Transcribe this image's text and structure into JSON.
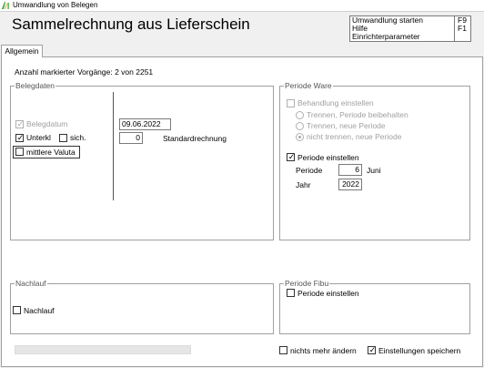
{
  "window": {
    "title": "Umwandlung von Belegen",
    "heading": "Sammelrechnung aus Lieferschein"
  },
  "shortcuts": [
    {
      "label": "Umwandlung starten",
      "key": "F9"
    },
    {
      "label": "Hilfe",
      "key": "F1"
    },
    {
      "label": "Einrichterparameter",
      "key": ""
    }
  ],
  "tabs": [
    {
      "label": "Allgemein"
    }
  ],
  "info": {
    "marked_count": "Anzahl markierter Vorgänge: 2 von 2251"
  },
  "belegdaten": {
    "legend": "Belegdaten",
    "belegdatum_label": "Belegdatum",
    "belegdatum_value": "09.06.2022",
    "belegdatum_checked": true,
    "unterkl_label": "Unterkl",
    "unterkl_checked": true,
    "sich_label": "sich.",
    "sich_checked": false,
    "number_value": "0",
    "standard_label": "Standardrechnung",
    "valuta_label": "mittlere Valuta",
    "valuta_checked": false
  },
  "periode_ware": {
    "legend": "Periode Ware",
    "behandlung_label": "Behandlung einstellen",
    "radio_options": [
      {
        "label": "Trennen, Periode beibehalten",
        "selected": false
      },
      {
        "label": "Trennen, neue Periode",
        "selected": false
      },
      {
        "label": "nicht trennen, neue Periode",
        "selected": true
      }
    ],
    "periode_einstellen_label": "Periode einstellen",
    "periode_einstellen_checked": true,
    "periode_label": "Periode",
    "periode_value": "6",
    "periode_month": "Juni",
    "jahr_label": "Jahr",
    "jahr_value": "2022"
  },
  "nachlauf": {
    "legend": "Nachlauf",
    "checkbox_label": "Nachlauf",
    "checked": false
  },
  "periode_fibu": {
    "legend": "Periode Fibu",
    "checkbox_label": "Periode einstellen",
    "checked": false
  },
  "footer": {
    "nichts_label": "nichts mehr ändern",
    "nichts_checked": false,
    "speichern_label": "Einstellungen speichern",
    "speichern_checked": true
  },
  "icons": {
    "app": "app-logo-icon",
    "check_mark": "✓"
  },
  "colors": {
    "background": "#f0f0f0",
    "panel": "#ffffff",
    "disabled_text": "#a0a0a0",
    "logo_green": "#2e9e3e",
    "logo_yellow": "#e0b000"
  }
}
